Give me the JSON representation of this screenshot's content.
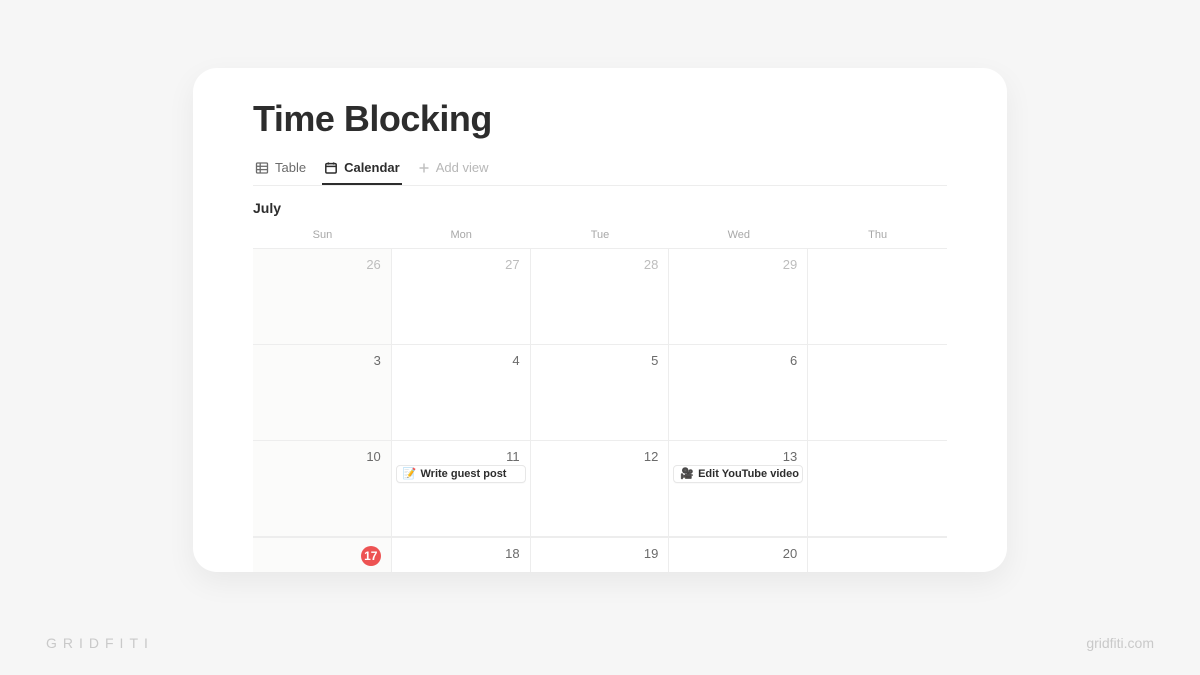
{
  "page": {
    "title": "Time Blocking"
  },
  "tabs": {
    "table": "Table",
    "calendar": "Calendar",
    "add_view": "Add view"
  },
  "calendar": {
    "month": "July",
    "weekdays": [
      "Sun",
      "Mon",
      "Tue",
      "Wed",
      "Thu"
    ],
    "rows": [
      {
        "days": [
          "26",
          "27",
          "28",
          "29",
          ""
        ],
        "muted": [
          true,
          true,
          true,
          true,
          true
        ]
      },
      {
        "days": [
          "3",
          "4",
          "5",
          "6",
          ""
        ]
      },
      {
        "days": [
          "10",
          "11",
          "12",
          "13",
          ""
        ]
      },
      {
        "days": [
          "17",
          "18",
          "19",
          "20",
          ""
        ],
        "today_index": 0
      }
    ],
    "events": [
      {
        "row": 2,
        "col": 1,
        "emoji": "📝",
        "title": "Write guest post"
      },
      {
        "row": 2,
        "col": 3,
        "emoji": "🎥",
        "title": "Edit YouTube video"
      }
    ]
  },
  "branding": {
    "wordmark": "GRIDFITI",
    "site": "gridfiti.com"
  },
  "colors": {
    "today_badge": "#ed5353"
  }
}
